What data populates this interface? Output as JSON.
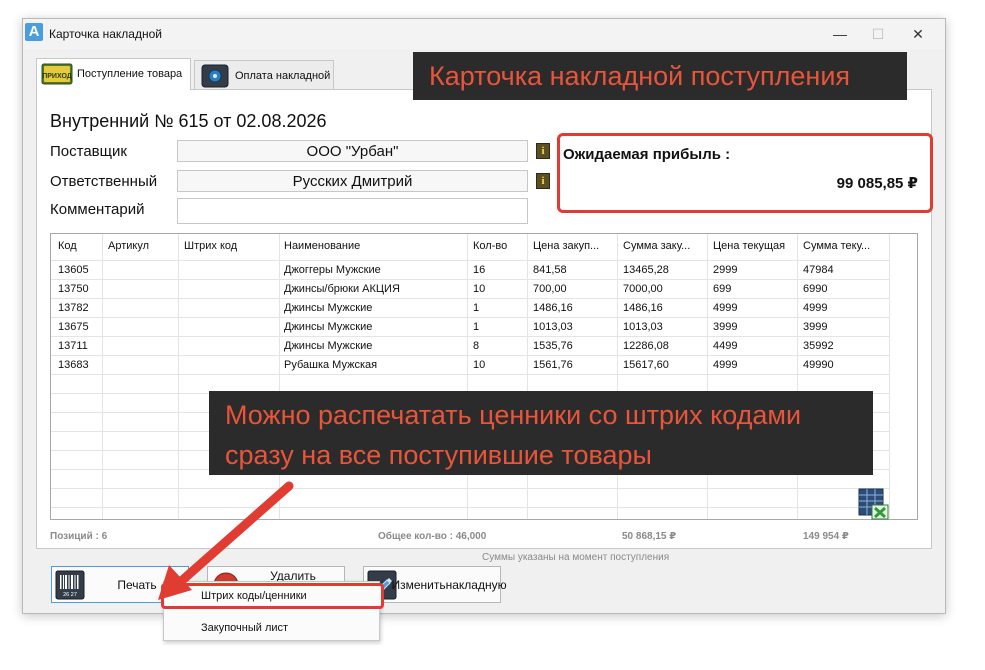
{
  "window": {
    "title": "Карточка накладной",
    "logo": "A",
    "minimize_icon": "—",
    "maximize_icon": "☐",
    "close_icon": "✕"
  },
  "tabs": [
    {
      "label": "Поступление товара",
      "icon": "prihod-stamp-icon",
      "icon_text": "ПРИХОД"
    },
    {
      "label": "Оплата накладной",
      "icon": "safe-icon"
    }
  ],
  "annotations": {
    "top": "Карточка накладной поступления",
    "middle_line1": "Можно распечатать ценники со штрих кодами",
    "middle_line2": "сразу на все поступившие товары"
  },
  "invoice": {
    "title": "Внутренний № 615 от 02.08.2026",
    "supplier_label": "Поставщик",
    "supplier_value": "ООО \"Урбан\"",
    "responsible_label": "Ответственный",
    "responsible_value": "Русских Дмитрий",
    "comment_label": "Комментарий",
    "comment_value": ""
  },
  "profit": {
    "label": "Ожидаемая прибыль :",
    "value": "99 085,85 ₽"
  },
  "table": {
    "headers": [
      "Код",
      "Артикул",
      "Штрих код",
      "Наименование",
      "Кол-во",
      "Цена закуп...",
      "Сумма заку...",
      "Цена текущая",
      "Сумма теку..."
    ],
    "rows": [
      [
        "13605",
        "",
        "",
        "Джоггеры Мужские",
        "16",
        "841,58",
        "13465,28",
        "2999",
        "47984"
      ],
      [
        "13750",
        "",
        "",
        "Джинсы/брюки АКЦИЯ",
        "10",
        "700,00",
        "7000,00",
        "699",
        "6990"
      ],
      [
        "13782",
        "",
        "",
        "Джинсы Мужские",
        "1",
        "1486,16",
        "1486,16",
        "4999",
        "4999"
      ],
      [
        "13675",
        "",
        "",
        "Джинсы Мужские",
        "1",
        "1013,03",
        "1013,03",
        "3999",
        "3999"
      ],
      [
        "13711",
        "",
        "",
        "Джинсы Мужские",
        "8",
        "1535,76",
        "12286,08",
        "4499",
        "35992"
      ],
      [
        "13683",
        "",
        "",
        "Рубашка Мужская",
        "10",
        "1561,76",
        "15617,60",
        "4999",
        "49990"
      ]
    ]
  },
  "summary": {
    "positions": "Позиций : 6",
    "total_qty": "Общее кол-во : 46,000",
    "purchase_sum": "50 868,15 ₽",
    "current_sum": "149 954 ₽",
    "note": "Суммы указаны на момент поступления"
  },
  "buttons": {
    "print": "Печать",
    "print_icon_text": "26 27",
    "delete": "Удалить",
    "edit_line1": "Изменить",
    "edit_line2": "накладную"
  },
  "menu": {
    "items": [
      "Штрих коды/ценники",
      "Закупочный лист"
    ]
  },
  "colors": {
    "accent_red": "#e03c31",
    "annotation_bg": "#2b2b2b",
    "annotation_text": "#e8553b",
    "selection_blue": "#4a9ee0"
  }
}
